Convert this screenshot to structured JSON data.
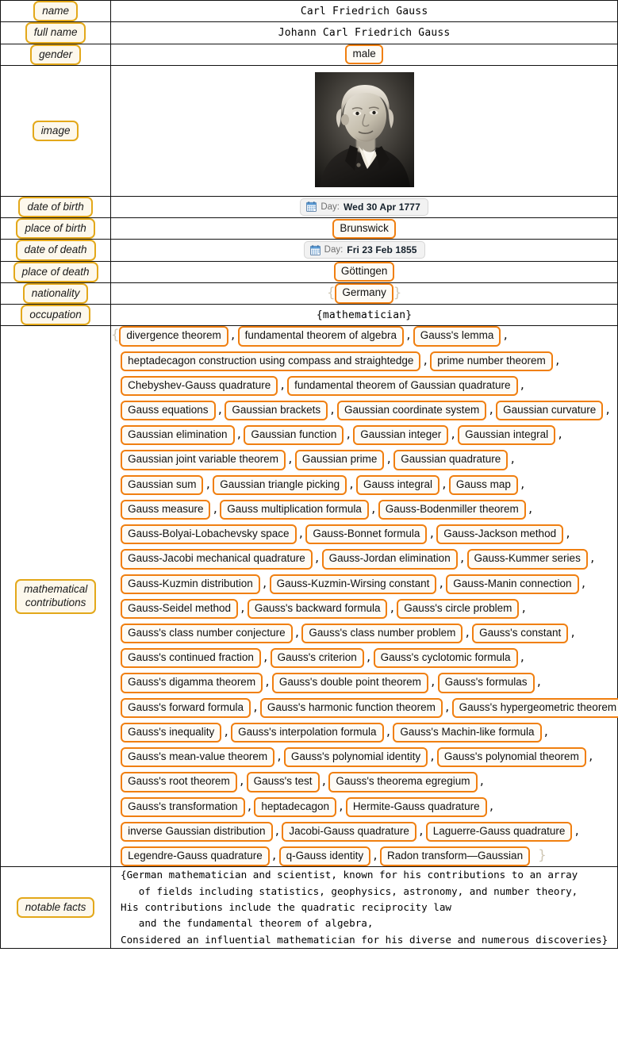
{
  "rows": {
    "name": {
      "label": "name",
      "value": "Carl Friedrich Gauss"
    },
    "full_name": {
      "label": "full name",
      "value": "Johann Carl Friedrich Gauss"
    },
    "gender": {
      "label": "gender",
      "value": "male"
    },
    "image": {
      "label": "image",
      "alt": "portrait-of-carl-friedrich-gauss"
    },
    "date_of_birth": {
      "label": "date of birth",
      "prefix": "Day:",
      "value": "Wed 30 Apr 1777",
      "icon": "calendar-icon"
    },
    "place_of_birth": {
      "label": "place of birth",
      "value": "Brunswick"
    },
    "date_of_death": {
      "label": "date of death",
      "prefix": "Day:",
      "value": "Fri 23 Feb 1855",
      "icon": "calendar-icon"
    },
    "place_of_death": {
      "label": "place of death",
      "value": "Göttingen"
    },
    "nationality": {
      "label": "nationality",
      "open_brace": "{",
      "value": "Germany",
      "close_brace": "}"
    },
    "occupation": {
      "label": "occupation",
      "text": "{mathematician}"
    },
    "mathematical_contributions": {
      "label": "mathematical\ncontributions",
      "open_brace": "{",
      "close_brace": "}"
    },
    "notable_facts": {
      "label": "notable facts"
    }
  },
  "contributions": [
    [
      "divergence theorem",
      "fundamental theorem of algebra",
      "Gauss's lemma"
    ],
    [
      "heptadecagon construction using compass and straightedge",
      "prime number theorem"
    ],
    [
      "Chebyshev-Gauss quadrature",
      "fundamental theorem of Gaussian quadrature"
    ],
    [
      "Gauss equations",
      "Gaussian brackets",
      "Gaussian coordinate system",
      "Gaussian curvature"
    ],
    [
      "Gaussian elimination",
      "Gaussian function",
      "Gaussian integer",
      "Gaussian integral"
    ],
    [
      "Gaussian joint variable theorem",
      "Gaussian prime",
      "Gaussian quadrature"
    ],
    [
      "Gaussian sum",
      "Gaussian triangle picking",
      "Gauss integral",
      "Gauss map"
    ],
    [
      "Gauss measure",
      "Gauss multiplication formula",
      "Gauss-Bodenmiller theorem"
    ],
    [
      "Gauss-Bolyai-Lobachevsky space",
      "Gauss-Bonnet formula",
      "Gauss-Jackson method"
    ],
    [
      "Gauss-Jacobi mechanical quadrature",
      "Gauss-Jordan elimination",
      "Gauss-Kummer series"
    ],
    [
      "Gauss-Kuzmin distribution",
      "Gauss-Kuzmin-Wirsing constant",
      "Gauss-Manin connection"
    ],
    [
      "Gauss-Seidel method",
      "Gauss's backward formula",
      "Gauss's circle problem"
    ],
    [
      "Gauss's class number conjecture",
      "Gauss's class number problem",
      "Gauss's constant"
    ],
    [
      "Gauss's continued fraction",
      "Gauss's criterion",
      "Gauss's cyclotomic formula"
    ],
    [
      "Gauss's digamma theorem",
      "Gauss's double point theorem",
      "Gauss's formulas"
    ],
    [
      "Gauss's forward formula",
      "Gauss's harmonic function theorem",
      "Gauss's hypergeometric theorem"
    ],
    [
      "Gauss's inequality",
      "Gauss's interpolation formula",
      "Gauss's Machin-like formula"
    ],
    [
      "Gauss's mean-value theorem",
      "Gauss's polynomial identity",
      "Gauss's polynomial theorem"
    ],
    [
      "Gauss's root theorem",
      "Gauss's test",
      "Gauss's theorema egregium"
    ],
    [
      "Gauss's transformation",
      "heptadecagon",
      "Hermite-Gauss quadrature"
    ],
    [
      "inverse Gaussian distribution",
      "Jacobi-Gauss quadrature",
      "Laguerre-Gauss quadrature"
    ],
    [
      "Legendre-Gauss quadrature",
      "q-Gauss identity",
      "Radon transform—Gaussian"
    ]
  ],
  "notable_facts_lines": [
    "{German mathematician and scientist, known for his contributions to an array",
    "   of fields including statistics, geophysics, astronomy, and number theory,",
    "His contributions include the quadratic reciprocity law",
    "   and the fundamental theorem of algebra,",
    "Considered an influential mathematician for his diverse and numerous discoveries}"
  ],
  "colors": {
    "label_border": "#e3a81a",
    "label_background": "#fdf8ec",
    "chip_border": "#f07f10",
    "chip_background": "#fefbf5",
    "table_border": "#111111",
    "brace": "#cfc7b4",
    "date_badge_background": "#f2f2f2"
  }
}
